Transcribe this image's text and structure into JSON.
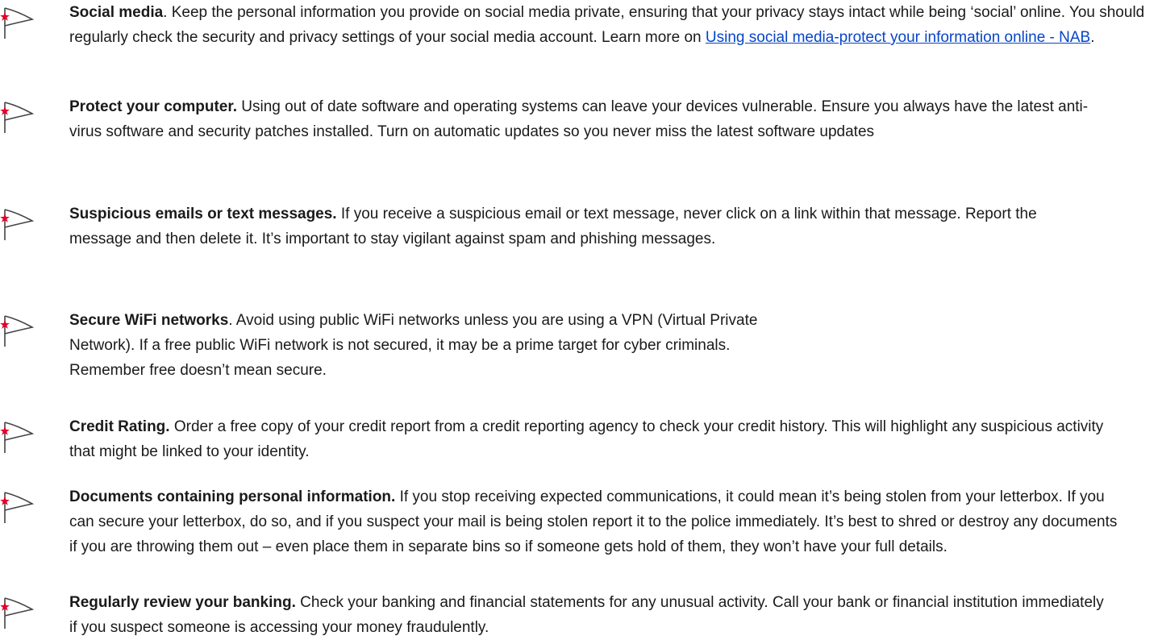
{
  "colors": {
    "flag_star": "#e4002b",
    "flag_outline": "#444444",
    "link": "#0645c8",
    "text": "#1a1a1a"
  },
  "tips": [
    {
      "icon": "nab-star-flag-icon",
      "title": "Social media",
      "title_punct": ".",
      "body": " Keep the personal information you provide on social media private, ensuring that your privacy stays intact while being ‘social’ online. You should regularly check the security and privacy settings of your social media account. Learn more on ",
      "link_text": "Using social media-protect your information online - NAB",
      "after_link": "."
    },
    {
      "icon": "nab-star-flag-icon",
      "title": "Protect your computer.",
      "body": " Using out of date software and operating systems can leave your devices vulnerable. Ensure you always have the latest anti-virus software and security patches installed. Turn on automatic updates so you never miss the latest software updates"
    },
    {
      "icon": "nab-star-flag-icon",
      "title": "Suspicious emails or text messages.",
      "body": " If you receive a suspicious email or text message, never click on a link within that message. Report the message and then delete it. It’s important to stay vigilant against spam and phishing messages."
    },
    {
      "icon": "nab-star-flag-icon",
      "title": "Secure WiFi networks",
      "title_punct": ".",
      "body_lines": [
        " Avoid using public WiFi networks unless you are using a VPN (Virtual Private",
        "Network). If a free public WiFi network is not secured, it may be a prime target for cyber criminals.",
        "Remember free doesn’t mean secure."
      ]
    },
    {
      "icon": "nab-star-flag-icon",
      "title": "Credit Rating.",
      "body": " Order a free copy of your credit report from a credit reporting agency to check your credit history. This will highlight any suspicious activity that might be linked to your identity."
    },
    {
      "icon": "nab-star-flag-icon",
      "title": "Documents containing personal information.",
      "body": " If you stop receiving expected communications, it could mean it’s being stolen from your letterbox. If you can secure your letterbox, do so, and if you suspect your mail is being stolen report it to the police immediately. It’s best to shred or destroy any documents if you are throwing them out – even place them in separate bins so if someone gets hold of them, they won’t have your full details."
    },
    {
      "icon": "nab-star-flag-icon",
      "title": "Regularly review your banking.",
      "body": " Check your banking and financial statements for any unusual activity. Call your bank or financial institution immediately if you suspect someone is accessing your money fraudulently."
    }
  ]
}
